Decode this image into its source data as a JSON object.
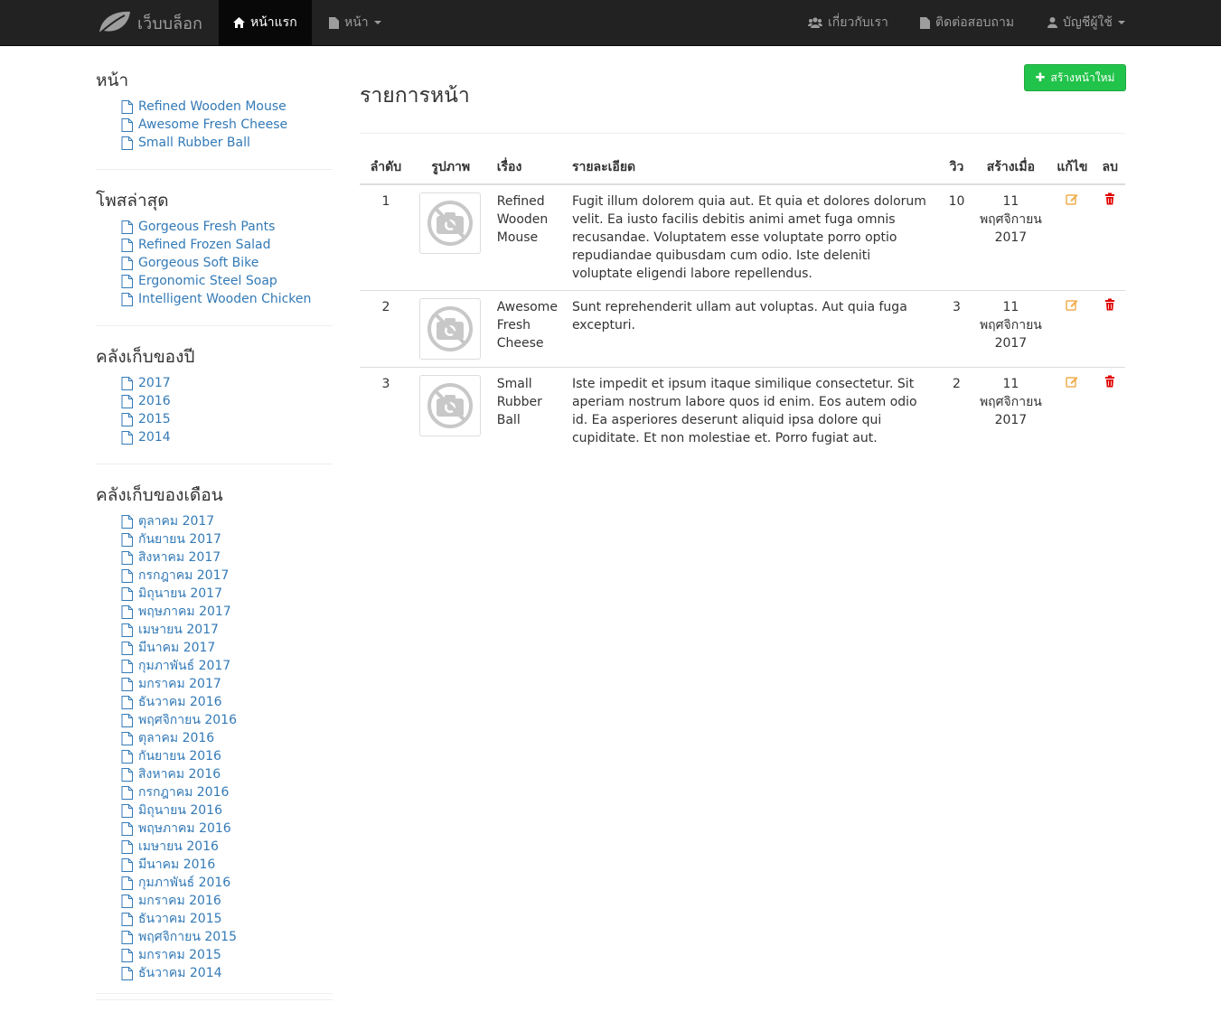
{
  "navbar": {
    "brand": "เว็บบล็อก",
    "home": "หน้าแรก",
    "pages": "หน้า",
    "about": "เกี่ยวกับเรา",
    "contact": "ติดต่อสอบถาม",
    "account": "บัญชีผู้ใช้"
  },
  "sidebar": {
    "pages_title": "หน้า",
    "pages": [
      "Refined Wooden Mouse",
      "Awesome Fresh Cheese",
      "Small Rubber Ball"
    ],
    "latest_title": "โพสล่าสุด",
    "latest": [
      "Gorgeous Fresh Pants",
      "Refined Frozen Salad",
      "Gorgeous Soft Bike",
      "Ergonomic Steel Soap",
      "Intelligent Wooden Chicken"
    ],
    "year_title": "คลังเก็บของปี",
    "years": [
      "2017",
      "2016",
      "2015",
      "2014"
    ],
    "month_title": "คลังเก็บของเดือน",
    "months": [
      "ตุลาคม 2017",
      "กันยายน 2017",
      "สิงหาคม 2017",
      "กรกฎาคม 2017",
      "มิถุนายน 2017",
      "พฤษภาคม 2017",
      "เมษายน 2017",
      "มีนาคม 2017",
      "กุมภาพันธ์ 2017",
      "มกราคม 2017",
      "ธันวาคม 2016",
      "พฤศจิกายน 2016",
      "ตุลาคม 2016",
      "กันยายน 2016",
      "สิงหาคม 2016",
      "กรกฎาคม 2016",
      "มิถุนายน 2016",
      "พฤษภาคม 2016",
      "เมษายน 2016",
      "มีนาคม 2016",
      "กุมภาพันธ์ 2016",
      "มกราคม 2016",
      "ธันวาคม 2015",
      "พฤศจิกายน 2015",
      "มกราคม 2015",
      "ธันวาคม 2014"
    ]
  },
  "main": {
    "title": "รายการหน้า",
    "create_label": "สร้างหน้าใหม่",
    "columns": [
      "ลำดับ",
      "รูปภาพ",
      "เรื่อง",
      "รายละเอียด",
      "วิว",
      "สร้างเมื่อ",
      "แก้ไข",
      "ลบ"
    ],
    "rows": [
      {
        "no": "1",
        "title": "Refined Wooden Mouse",
        "detail": "Fugit illum dolorem quia aut. Et quia et dolores dolorum velit. Ea iusto facilis debitis animi amet fuga omnis recusandae. Voluptatem esse voluptate porro optio repudiandae quibusdam cum odio. Iste deleniti voluptate eligendi labore repellendus.",
        "views": "10",
        "created": "11 พฤศจิกายน 2017"
      },
      {
        "no": "2",
        "title": "Awesome Fresh Cheese",
        "detail": "Sunt reprehenderit ullam aut voluptas. Aut quia fuga excepturi.",
        "views": "3",
        "created": "11 พฤศจิกายน 2017"
      },
      {
        "no": "3",
        "title": "Small Rubber Ball",
        "detail": "Iste impedit et ipsum itaque similique consectetur. Sit aperiam nostrum labore quos id enim. Eos autem odio id. Ea asperiores deserunt aliquid ipsa dolore qui cupiditate. Et non molestiae et. Porro fugiat aut.",
        "views": "2",
        "created": "11 พฤศจิกายน 2017"
      }
    ]
  },
  "colors": {
    "navbar": "#222222",
    "link": "#337ab7",
    "create_button": "#22c34a",
    "edit_icon": "#f0ad4e",
    "delete_icon": "#e00000"
  },
  "icons": {
    "brand": "leaf-icon",
    "home": "home-icon",
    "pages": "file-icon",
    "about": "users-icon",
    "contact": "file-icon",
    "account": "user-icon",
    "list_item": "file-outline-icon",
    "create": "plus-icon",
    "edit": "edit-icon",
    "delete": "trash-icon",
    "thumbnail": "no-camera-icon"
  }
}
